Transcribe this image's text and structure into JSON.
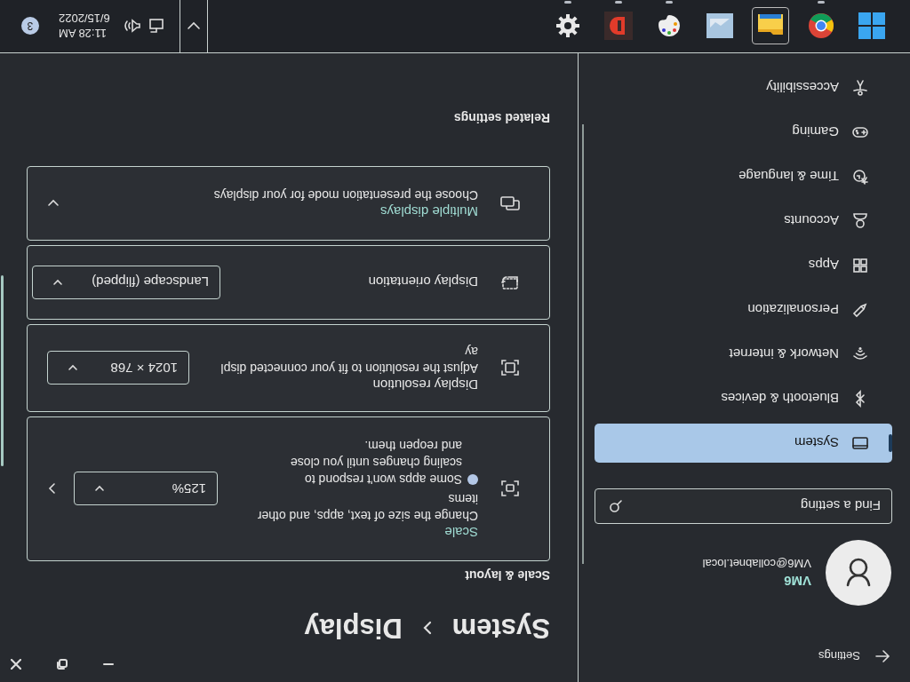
{
  "window": {
    "title": "Settings"
  },
  "profile": {
    "name": "VM6",
    "email": "VM6@collabnet.local"
  },
  "search": {
    "placeholder": "Find a setting"
  },
  "nav": {
    "items": [
      {
        "label": "System",
        "selected": true
      },
      {
        "label": "Bluetooth & devices",
        "selected": false
      },
      {
        "label": "Network & internet",
        "selected": false
      },
      {
        "label": "Personalization",
        "selected": false
      },
      {
        "label": "Apps",
        "selected": false
      },
      {
        "label": "Accounts",
        "selected": false
      },
      {
        "label": "Time & language",
        "selected": false
      },
      {
        "label": "Gaming",
        "selected": false
      },
      {
        "label": "Accessibility",
        "selected": false
      }
    ]
  },
  "breadcrumb": [
    "System",
    "Display"
  ],
  "section": "Scale & layout",
  "cards": [
    {
      "kind": "scale",
      "title": "Scale",
      "description": "Change the size of text, apps, and other items",
      "warning": "Some apps won't respond to scaling changes until you close and reopen them.",
      "value": "125%"
    },
    {
      "kind": "resolution",
      "title": "Display resolution",
      "description": "Adjust the resolution to fit your connected display",
      "value": "1024 × 768"
    },
    {
      "kind": "orientation",
      "title": "Display orientation",
      "value": "Landscape (flipped)"
    },
    {
      "kind": "multiple",
      "title": "Multiple displays",
      "description": "Choose the presentation mode for your displays"
    }
  ],
  "related": "Related settings",
  "taskbar": {
    "apps": [
      {
        "running": false,
        "hovered": false
      },
      {
        "running": true,
        "hovered": false
      },
      {
        "running": false,
        "hovered": true
      },
      {
        "running": false,
        "hovered": false
      },
      {
        "running": true,
        "hovered": false
      },
      {
        "running": true,
        "hovered": false
      },
      {
        "running": true,
        "hovered": false
      }
    ],
    "time": "11:28 AM",
    "date": "6/15/2022",
    "notifications": "3"
  }
}
